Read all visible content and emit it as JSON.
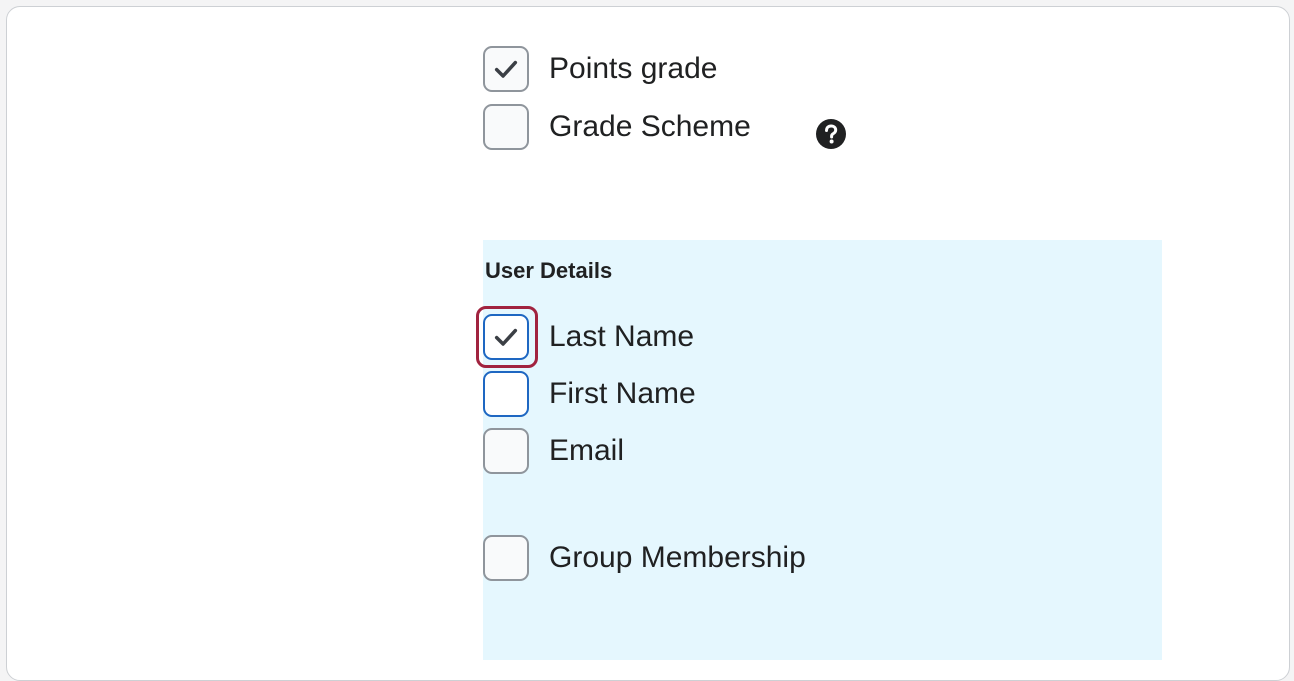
{
  "grade_options": {
    "points_grade": {
      "label": "Points grade",
      "checked": true
    },
    "grade_scheme": {
      "label": "Grade Scheme",
      "checked": false
    }
  },
  "help": {
    "icon": "question-circle-icon"
  },
  "user_details": {
    "title": "User Details",
    "last_name": {
      "label": "Last Name",
      "checked": true
    },
    "first_name": {
      "label": "First Name",
      "checked": false
    },
    "email": {
      "label": "Email",
      "checked": false
    },
    "group_membership": {
      "label": "Group Membership",
      "checked": false
    }
  },
  "colors": {
    "section_background": "#e5f7fe",
    "focus_border": "#1e67c2",
    "highlight_border": "#a1233f"
  }
}
